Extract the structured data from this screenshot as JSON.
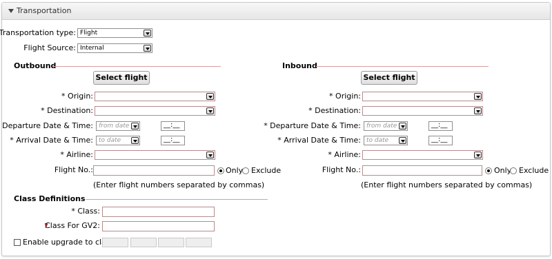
{
  "panel": {
    "title": "Transportation"
  },
  "top": {
    "transport_type_label": "Transportation type:",
    "transport_type_value": "Flight",
    "flight_source_label": "Flight Source:",
    "flight_source_value": "Internal"
  },
  "outbound": {
    "section_title": "Outbound",
    "select_flight_label": "Select flight",
    "origin_label": "* Origin:",
    "destination_label": "* Destination:",
    "departure_label": "* Departure Date & Time:",
    "departure_date_placeholder": "from date",
    "departure_time": "__:__",
    "arrival_label": "* Arrival Date & Time:",
    "arrival_date_placeholder": "to date",
    "arrival_time": "__:__",
    "airline_label": "* Airline:",
    "flight_no_label": "Flight No.:",
    "only_label": "Only",
    "exclude_label": "Exclude",
    "flight_hint": "(Enter flight numbers separated by commas)"
  },
  "inbound": {
    "section_title": "Inbound",
    "select_flight_label": "Select flight",
    "origin_label": "* Origin:",
    "destination_label": "* Destination:",
    "departure_label": "* Departure Date & Time:",
    "departure_date_placeholder": "from date",
    "departure_time": "__:__",
    "arrival_label": "* Arrival Date & Time:",
    "arrival_date_placeholder": "to date",
    "arrival_time": "__:__",
    "airline_label": "* Airline:",
    "flight_no_label": "Flight No.:",
    "only_label": "Only",
    "exclude_label": "Exclude",
    "flight_hint": "(Enter flight numbers separated by commas)"
  },
  "class_defs": {
    "section_title": "Class Definitions",
    "class_label": "* Class:",
    "class_gv2_label": "Class For GV2:",
    "upgrade_label": "Enable upgrade to class"
  }
}
